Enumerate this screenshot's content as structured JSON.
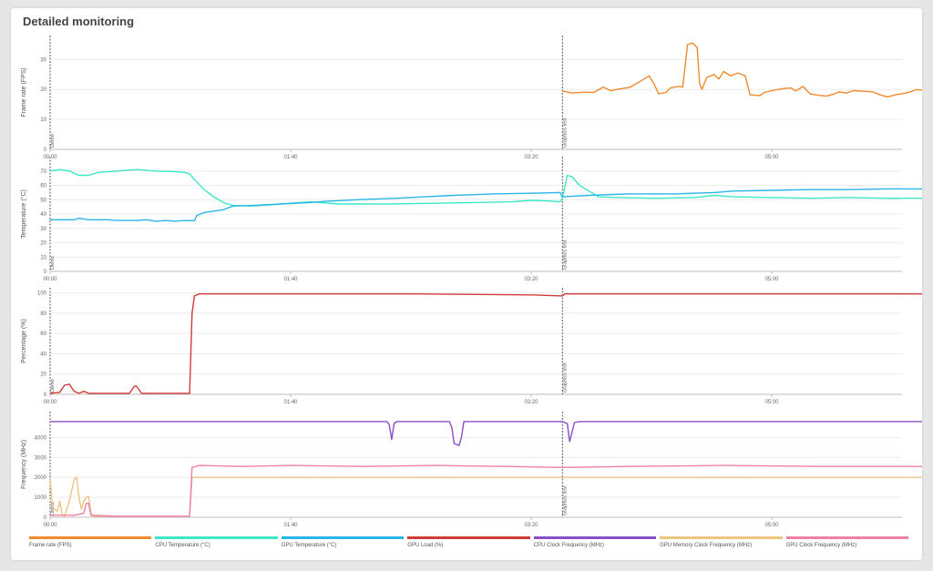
{
  "page": {
    "title": "Detailed monitoring"
  },
  "chart_data": [
    {
      "type": "line",
      "ylabel": "Frame rate (FPS)",
      "ylim": [
        0,
        38
      ],
      "yticks": [
        0,
        10,
        20,
        30
      ],
      "xlim": [
        0,
        420
      ],
      "xticks": [
        "00:00",
        "01:40",
        "03:20",
        "05:00"
      ],
      "markers": [
        {
          "x": 0,
          "label": "Demo"
        },
        {
          "x": 213,
          "label": "Graphics test"
        }
      ],
      "series": [
        {
          "name": "Frame rate (FPS)",
          "color": "#f08a2c",
          "points": [
            [
              213,
              19.5
            ],
            [
              217,
              18.8
            ],
            [
              222,
              19.1
            ],
            [
              226,
              19.0
            ],
            [
              230,
              20.8
            ],
            [
              233,
              19.6
            ],
            [
              237,
              20.2
            ],
            [
              241,
              20.7
            ],
            [
              246,
              23
            ],
            [
              249,
              24.5
            ],
            [
              251,
              22
            ],
            [
              253,
              18.5
            ],
            [
              256,
              19
            ],
            [
              258,
              20.5
            ],
            [
              261,
              21
            ],
            [
              263,
              20.8
            ],
            [
              265,
              35
            ],
            [
              267,
              35.5
            ],
            [
              269,
              34
            ],
            [
              270,
              22
            ],
            [
              271,
              20
            ],
            [
              273,
              24
            ],
            [
              276,
              25
            ],
            [
              278,
              23.5
            ],
            [
              280,
              26
            ],
            [
              283,
              24.5
            ],
            [
              286,
              25.5
            ],
            [
              289,
              24.5
            ],
            [
              291,
              18.2
            ],
            [
              295,
              17.9
            ],
            [
              297,
              19
            ],
            [
              301,
              19.8
            ],
            [
              305,
              20.3
            ],
            [
              308,
              20.5
            ],
            [
              310,
              19.5
            ],
            [
              313,
              21
            ],
            [
              316,
              18.5
            ],
            [
              320,
              18
            ],
            [
              323,
              17.8
            ],
            [
              326,
              18.5
            ],
            [
              328,
              19.2
            ],
            [
              331,
              18.8
            ],
            [
              334,
              19.6
            ],
            [
              338,
              19.4
            ],
            [
              342,
              19.2
            ],
            [
              345,
              18.2
            ],
            [
              348,
              17.5
            ],
            [
              352,
              18.3
            ],
            [
              356,
              18.8
            ],
            [
              360,
              19.9
            ],
            [
              363,
              19.8
            ],
            [
              366,
              19.1
            ]
          ]
        }
      ]
    },
    {
      "type": "line",
      "ylabel": "Temperature (°C)",
      "ylim": [
        0,
        80
      ],
      "yticks": [
        0,
        10,
        20,
        30,
        40,
        50,
        60,
        70
      ],
      "xlim": [
        0,
        420
      ],
      "xticks": [
        "00:00",
        "01:40",
        "03:20",
        "05:00"
      ],
      "markers": [
        {
          "x": 0,
          "label": "Demo"
        },
        {
          "x": 213,
          "label": "Graphics test"
        }
      ],
      "series": [
        {
          "name": "CPU Temperature (°C)",
          "color": "#3de8c8",
          "points": [
            [
              0,
              70
            ],
            [
              4,
              71
            ],
            [
              8,
              70
            ],
            [
              12,
              67
            ],
            [
              16,
              67
            ],
            [
              20,
              69
            ],
            [
              28,
              70
            ],
            [
              36,
              71
            ],
            [
              44,
              70
            ],
            [
              52,
              69.5
            ],
            [
              56,
              69
            ],
            [
              58,
              68
            ],
            [
              60,
              64
            ],
            [
              64,
              57
            ],
            [
              68,
              52
            ],
            [
              72,
              48
            ],
            [
              76,
              46
            ],
            [
              84,
              45.5
            ],
            [
              96,
              47
            ],
            [
              108,
              48.5
            ],
            [
              120,
              47
            ],
            [
              140,
              47
            ],
            [
              160,
              47.5
            ],
            [
              176,
              48
            ],
            [
              192,
              48.5
            ],
            [
              200,
              49.5
            ],
            [
              208,
              49
            ],
            [
              212,
              48.5
            ],
            [
              213,
              51
            ],
            [
              215,
              67
            ],
            [
              217,
              66
            ],
            [
              220,
              60
            ],
            [
              224,
              56
            ],
            [
              228,
              52
            ],
            [
              236,
              51.5
            ],
            [
              252,
              51
            ],
            [
              268,
              51.5
            ],
            [
              276,
              53
            ],
            [
              284,
              52
            ],
            [
              300,
              51.5
            ],
            [
              316,
              51
            ],
            [
              332,
              51.5
            ],
            [
              348,
              51
            ],
            [
              366,
              51
            ]
          ]
        },
        {
          "name": "GPU Temperature (°C)",
          "color": "#2ab5ea",
          "points": [
            [
              0,
              36
            ],
            [
              10,
              36
            ],
            [
              12,
              37
            ],
            [
              16,
              36
            ],
            [
              24,
              36
            ],
            [
              28,
              35.5
            ],
            [
              36,
              35.5
            ],
            [
              40,
              36
            ],
            [
              44,
              35
            ],
            [
              48,
              35.5
            ],
            [
              52,
              35
            ],
            [
              56,
              35.5
            ],
            [
              60,
              35.3
            ],
            [
              61,
              39
            ],
            [
              64,
              41
            ],
            [
              68,
              42
            ],
            [
              72,
              43
            ],
            [
              76,
              45.5
            ],
            [
              84,
              46
            ],
            [
              96,
              47
            ],
            [
              108,
              48
            ],
            [
              116,
              49
            ],
            [
              128,
              50
            ],
            [
              144,
              51
            ],
            [
              156,
              52
            ],
            [
              168,
              53
            ],
            [
              184,
              54
            ],
            [
              200,
              54.5
            ],
            [
              212,
              55
            ],
            [
              213,
              52
            ],
            [
              224,
              53
            ],
            [
              240,
              54
            ],
            [
              260,
              54
            ],
            [
              276,
              55
            ],
            [
              284,
              56
            ],
            [
              300,
              56.5
            ],
            [
              316,
              57
            ],
            [
              332,
              57
            ],
            [
              348,
              57.5
            ],
            [
              366,
              57.5
            ]
          ]
        }
      ]
    },
    {
      "type": "line",
      "ylabel": "Percentage (%)",
      "ylim": [
        0,
        105
      ],
      "yticks": [
        0,
        20,
        40,
        60,
        80,
        100
      ],
      "xlim": [
        0,
        420
      ],
      "xticks": [
        "00:00",
        "01:40",
        "03:20",
        "05:00"
      ],
      "markers": [
        {
          "x": 0,
          "label": "Demo"
        },
        {
          "x": 213,
          "label": "Graphics test"
        }
      ],
      "series": [
        {
          "name": "GPU Load (%)",
          "color": "#d23a3a",
          "points": [
            [
              0,
              1
            ],
            [
              4,
              2
            ],
            [
              6,
              9
            ],
            [
              8,
              10
            ],
            [
              10,
              3
            ],
            [
              12,
              1
            ],
            [
              14,
              3
            ],
            [
              16,
              1
            ],
            [
              30,
              1
            ],
            [
              33,
              1
            ],
            [
              35,
              8
            ],
            [
              36,
              8
            ],
            [
              38,
              1
            ],
            [
              58,
              1
            ],
            [
              59,
              80
            ],
            [
              60,
              97
            ],
            [
              62,
              99
            ],
            [
              80,
              99
            ],
            [
              130,
              99
            ],
            [
              150,
              99
            ],
            [
              200,
              98
            ],
            [
              213,
              97
            ],
            [
              214,
              99
            ],
            [
              366,
              99
            ]
          ]
        }
      ]
    },
    {
      "type": "line",
      "ylabel": "Frequency (MHz)",
      "ylim": [
        0,
        5300
      ],
      "yticks": [
        0,
        1000,
        2000,
        3000,
        4000
      ],
      "xlim": [
        0,
        420
      ],
      "xticks": [
        "00:00",
        "01:40",
        "03:20",
        "05:00"
      ],
      "markers": [
        {
          "x": 0,
          "label": "Demo"
        },
        {
          "x": 213,
          "label": "Graphics test"
        }
      ],
      "series": [
        {
          "name": "CPU Clock Frequency (MHz)",
          "color": "#8a4ec6",
          "points": [
            [
              0,
              4800
            ],
            [
              40,
              4800
            ],
            [
              80,
              4800
            ],
            [
              140,
              4800
            ],
            [
              141,
              4650
            ],
            [
              142,
              3900
            ],
            [
              143,
              4700
            ],
            [
              144,
              4800
            ],
            [
              166,
              4800
            ],
            [
              167,
              4500
            ],
            [
              168,
              3700
            ],
            [
              170,
              3600
            ],
            [
              171,
              4000
            ],
            [
              172,
              4800
            ],
            [
              213,
              4800
            ],
            [
              215,
              4700
            ],
            [
              216,
              3800
            ],
            [
              218,
              4750
            ],
            [
              220,
              4800
            ],
            [
              366,
              4800
            ]
          ]
        },
        {
          "name": "GPU Memory Clock Frequency (MHz)",
          "color": "#ecc580",
          "points": [
            [
              0,
              1900
            ],
            [
              1,
              500
            ],
            [
              3,
              300
            ],
            [
              4,
              800
            ],
            [
              5,
              150
            ],
            [
              6,
              50
            ],
            [
              8,
              800
            ],
            [
              10,
              1900
            ],
            [
              11,
              2000
            ],
            [
              12,
              1000
            ],
            [
              13,
              400
            ],
            [
              14,
              800
            ],
            [
              15,
              1000
            ],
            [
              16,
              1050
            ],
            [
              17,
              200
            ],
            [
              18,
              50
            ],
            [
              58,
              50
            ],
            [
              59,
              2000
            ],
            [
              366,
              2000
            ]
          ]
        },
        {
          "name": "GPU Clock Frequency (MHz)",
          "color": "#ee7fa6",
          "points": [
            [
              0,
              100
            ],
            [
              10,
              100
            ],
            [
              14,
              200
            ],
            [
              15,
              700
            ],
            [
              16,
              700
            ],
            [
              17,
              100
            ],
            [
              28,
              50
            ],
            [
              58,
              50
            ],
            [
              59,
              2500
            ],
            [
              62,
              2600
            ],
            [
              80,
              2550
            ],
            [
              100,
              2600
            ],
            [
              130,
              2550
            ],
            [
              160,
              2600
            ],
            [
              190,
              2550
            ],
            [
              213,
              2500
            ],
            [
              240,
              2550
            ],
            [
              280,
              2600
            ],
            [
              320,
              2550
            ],
            [
              366,
              2550
            ]
          ]
        }
      ]
    }
  ],
  "legend": [
    {
      "label": "Frame rate (FPS)",
      "color": "#f08a2c"
    },
    {
      "label": "CPU Temperature (°C)",
      "color": "#3de8c8"
    },
    {
      "label": "GPU Temperature (°C)",
      "color": "#2ab5ea"
    },
    {
      "label": "GPU Load (%)",
      "color": "#d23a3a"
    },
    {
      "label": "CPU Clock Frequency (MHz)",
      "color": "#8a4ec6"
    },
    {
      "label": "GPU Memory Clock Frequency (MHz)",
      "color": "#ecc580"
    },
    {
      "label": "GPU Clock Frequency (MHz)",
      "color": "#ee7fa6"
    }
  ]
}
